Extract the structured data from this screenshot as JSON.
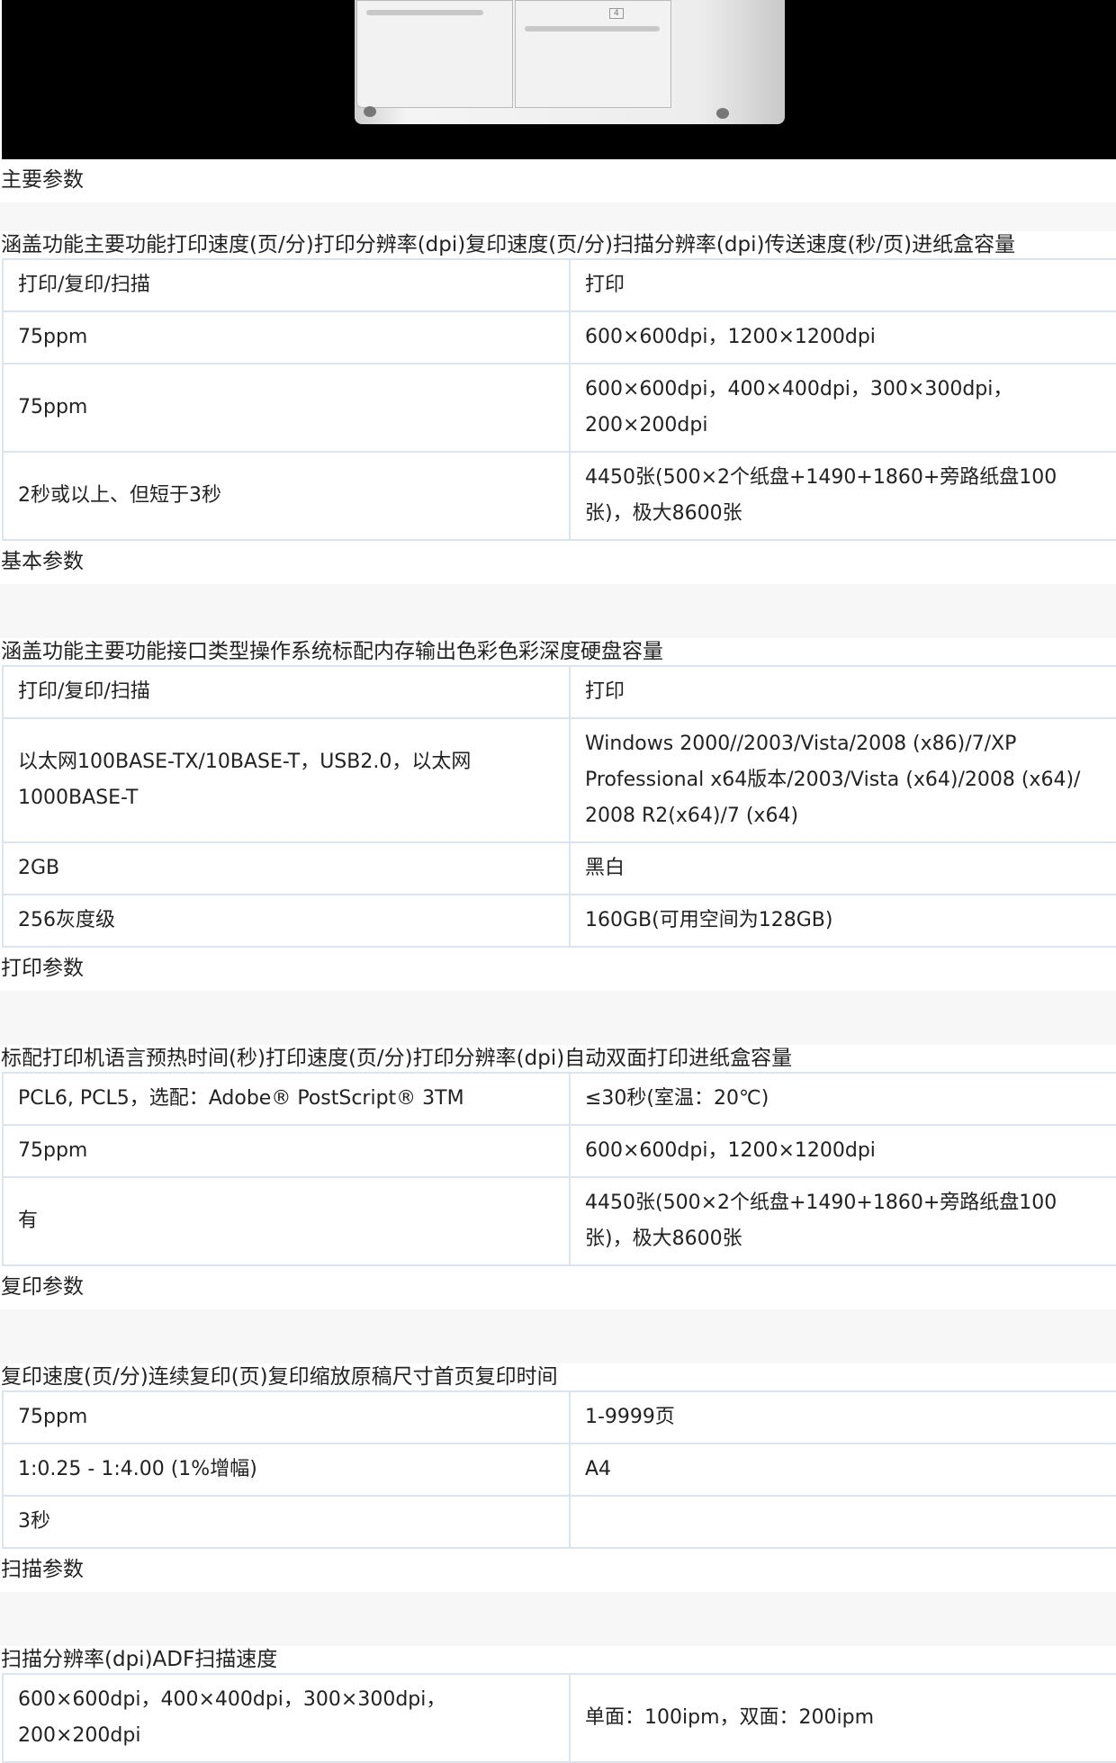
{
  "sections": {
    "main": {
      "title": "主要参数",
      "headline": "涵盖功能主要功能打印速度(页/分)打印分辨率(dpi)复印速度(页/分)扫描分辨率(dpi)传送速度(秒/页)进纸盒容量",
      "rows": [
        [
          "打印/复印/扫描",
          "打印"
        ],
        [
          "75ppm",
          "600×600dpi，1200×1200dpi"
        ],
        [
          "75ppm",
          "600×600dpi，400×400dpi，300×300dpi，200×200dpi"
        ],
        [
          "2秒或以上、但短于3秒",
          "4450张(500×2个纸盘+1490+1860+旁路纸盘100张)，极大8600张"
        ]
      ]
    },
    "basic": {
      "title": "基本参数",
      "headline": "涵盖功能主要功能接口类型操作系统标配内存输出色彩色彩深度硬盘容量",
      "rows": [
        [
          "打印/复印/扫描",
          "打印"
        ],
        [
          "以太网100BASE-TX/10BASE-T，USB2.0，以太网1000BASE-T",
          "Windows 2000//2003/Vista/2008 (x86)/7/XP Professional x64版本/2003/Vista (x64)/2008 (x64)/ 2008 R2(x64)/7 (x64)"
        ],
        [
          "2GB",
          "黑白"
        ],
        [
          "256灰度级",
          "160GB(可用空间为128GB)"
        ]
      ]
    },
    "print": {
      "title": "打印参数",
      "headline": "标配打印机语言预热时间(秒)打印速度(页/分)打印分辨率(dpi)自动双面打印进纸盒容量",
      "rows": [
        [
          "PCL6, PCL5，选配：Adobe® PostScript® 3TM",
          "≤30秒(室温：20℃)"
        ],
        [
          "75ppm",
          "600×600dpi，1200×1200dpi"
        ],
        [
          "有",
          "4450张(500×2个纸盘+1490+1860+旁路纸盘100张)，极大8600张"
        ]
      ]
    },
    "copy": {
      "title": "复印参数",
      "headline": "复印速度(页/分)连续复印(页)复印缩放原稿尺寸首页复印时间",
      "rows": [
        [
          "75ppm",
          "1-9999页"
        ],
        [
          "1:0.25 - 1:4.00 (1%增幅)",
          "A4"
        ],
        [
          "3秒",
          ""
        ]
      ]
    },
    "scan": {
      "title": "扫描参数",
      "headline": "扫描分辨率(dpi)ADF扫描速度",
      "rows": [
        [
          "600×600dpi，400×400dpi，300×300dpi，200×200dpi",
          "单面：100ipm，双面：200ipm"
        ]
      ]
    }
  },
  "hero": {
    "tray_label": "4"
  },
  "colors": {
    "link": "#2255aa",
    "border": "#dbe5f0",
    "band": "#f7f7f7"
  }
}
